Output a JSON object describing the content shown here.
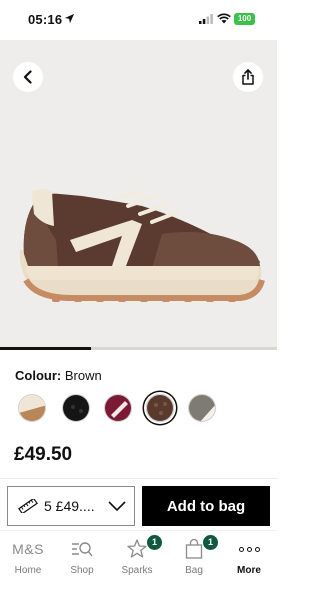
{
  "status_bar": {
    "time": "05:16",
    "battery": "100"
  },
  "product": {
    "colour_label": "Colour:",
    "colour_value": "Brown",
    "price": "£49.50",
    "swatches": [
      {
        "name": "cream-tan",
        "selected": false
      },
      {
        "name": "black",
        "selected": false
      },
      {
        "name": "burgundy",
        "selected": false
      },
      {
        "name": "brown",
        "selected": true
      },
      {
        "name": "grey-white",
        "selected": false
      }
    ]
  },
  "carousel": {
    "position": 0.33
  },
  "action_bar": {
    "size_value": "5 £49....",
    "add_to_bag_label": "Add to bag"
  },
  "tab_bar": {
    "items": [
      {
        "label": "Home",
        "icon": "M&S"
      },
      {
        "label": "Shop",
        "icon": "search-icon"
      },
      {
        "label": "Sparks",
        "icon": "sparks-icon",
        "badge": "1"
      },
      {
        "label": "Bag",
        "icon": "bag-icon",
        "badge": "1"
      },
      {
        "label": "More",
        "icon": "more-icon"
      }
    ]
  },
  "colors": {
    "accent": "#000000",
    "badge": "#0f5a3c",
    "battery": "#3bc14a"
  }
}
